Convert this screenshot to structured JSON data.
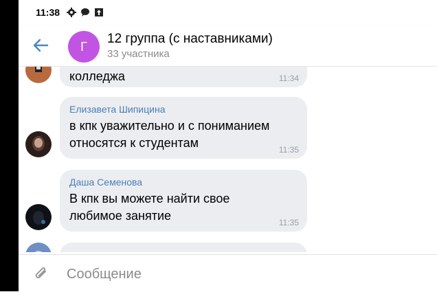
{
  "status_bar": {
    "time": "11:38",
    "icons": [
      "gear-icon",
      "chat-bubble-icon",
      "upload-icon"
    ]
  },
  "header": {
    "back_icon": "arrow-left-icon",
    "avatar_letter": "Г",
    "avatar_color": "#c254e3",
    "title": "12 группа (с наставниками)",
    "subtitle": "33 участника"
  },
  "messages": [
    {
      "sender": "",
      "text": "колледжа",
      "time": "11:34"
    },
    {
      "sender": "Елизавета Шипицина",
      "text": "в кпк уважительно и с пониманием\nотносятся к студентам",
      "time": "11:35"
    },
    {
      "sender": "Даша Семенова",
      "text": "В кпк вы можете найти свое\nлюбимое занятие",
      "time": "11:35"
    }
  ],
  "composer": {
    "attach_icon": "paperclip-icon",
    "placeholder": "Сообщение"
  },
  "colors": {
    "accent": "#4a7fb5",
    "bubble": "#ebedf0"
  }
}
